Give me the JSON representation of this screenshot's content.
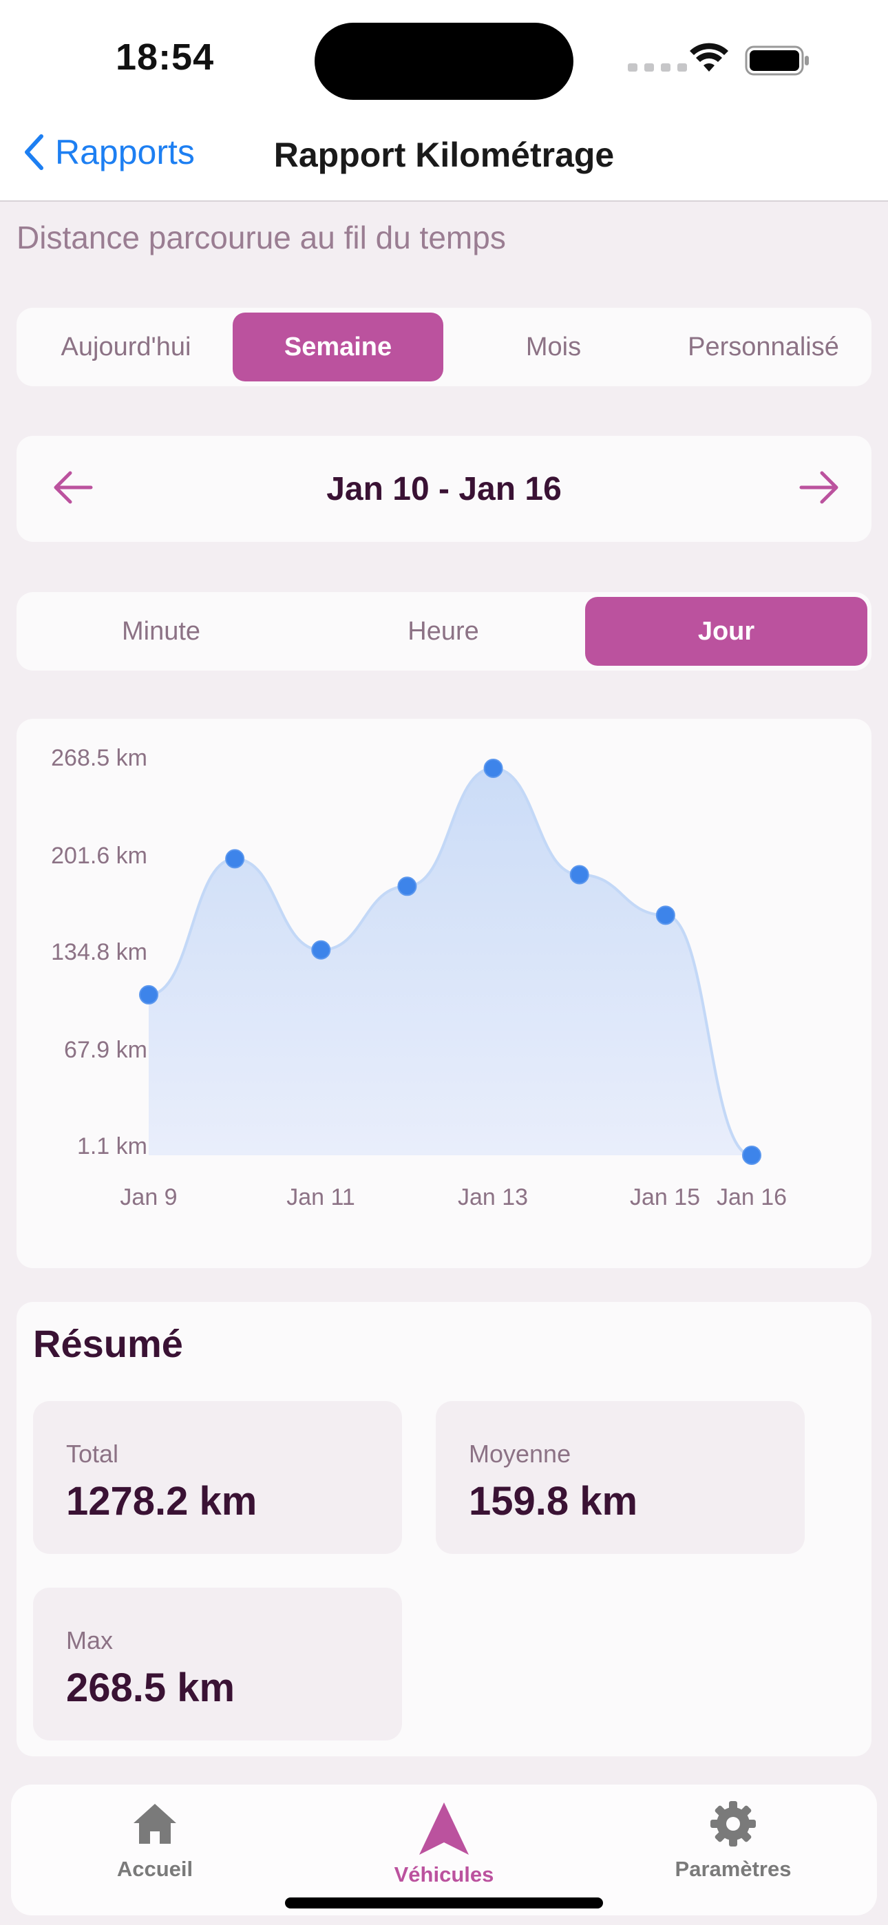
{
  "status_bar": {
    "time": "18:54"
  },
  "nav": {
    "back_label": "Rapports",
    "title": "Rapport Kilométrage"
  },
  "subtitle": "Distance parcourue au fil du temps",
  "period_tabs": {
    "options": [
      "Aujourd'hui",
      "Semaine",
      "Mois",
      "Personnalisé"
    ],
    "selected": "Semaine"
  },
  "date_range": {
    "label": "Jan 10 - Jan 16"
  },
  "granularity_tabs": {
    "options": [
      "Minute",
      "Heure",
      "Jour"
    ],
    "selected": "Jour"
  },
  "chart_data": {
    "type": "area",
    "x": [
      "Jan 9",
      "Jan 10",
      "Jan 11",
      "Jan 12",
      "Jan 13",
      "Jan 14",
      "Jan 15",
      "Jan 16"
    ],
    "values": [
      112,
      206,
      143,
      187,
      268.5,
      195,
      167,
      1.1
    ],
    "x_tick_labels": [
      "Jan 9",
      "Jan 11",
      "Jan 13",
      "Jan 15",
      "Jan 16"
    ],
    "y_tick_labels": [
      "268.5 km",
      "201.6 km",
      "134.8 km",
      "67.9 km",
      "1.1 km"
    ],
    "ylim": [
      1.1,
      268.5
    ],
    "title": "",
    "xlabel": "",
    "ylabel": "",
    "line_color": "#c3d8f7",
    "fill_color": "#cbdcf7",
    "point_color": "#3d84ea"
  },
  "summary": {
    "title": "Résumé",
    "stats": [
      {
        "label": "Total",
        "value": "1278.2 km"
      },
      {
        "label": "Moyenne",
        "value": "159.8 km"
      },
      {
        "label": "Max",
        "value": "268.5 km"
      }
    ]
  },
  "tab_bar": {
    "items": [
      {
        "label": "Accueil",
        "icon": "house-icon"
      },
      {
        "label": "Véhicules",
        "icon": "navigation-arrow-icon"
      },
      {
        "label": "Paramètres",
        "icon": "gear-icon"
      }
    ],
    "active": "Véhicules"
  },
  "colors": {
    "accent": "#bb529e",
    "link": "#1d7ff2",
    "background": "#f3eef2"
  }
}
